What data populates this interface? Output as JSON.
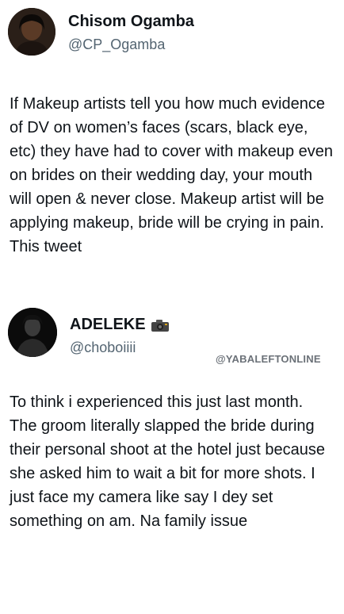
{
  "main_tweet": {
    "author_name": "Chisom Ogamba",
    "handle": "@CP_Ogamba",
    "text": "If Makeup artists tell you how much evidence of DV on women’s faces (scars, black eye, etc) they have had to cover with makeup even on brides on their wedding day, your mouth will open & never close. Makeup artist will be applying makeup, bride will be crying in pain. This tweet"
  },
  "reply_tweet": {
    "author_name": "ADELEKE",
    "author_icon": "camera-icon",
    "handle": "@choboiiii",
    "text": "To think i experienced this just last month.\nThe groom literally slapped the bride during their personal shoot at the hotel just because she asked him to wait a bit for more shots. I just face my camera like say I dey set something on am. Na family issue"
  },
  "watermark": "@YABALEFTONLINE"
}
